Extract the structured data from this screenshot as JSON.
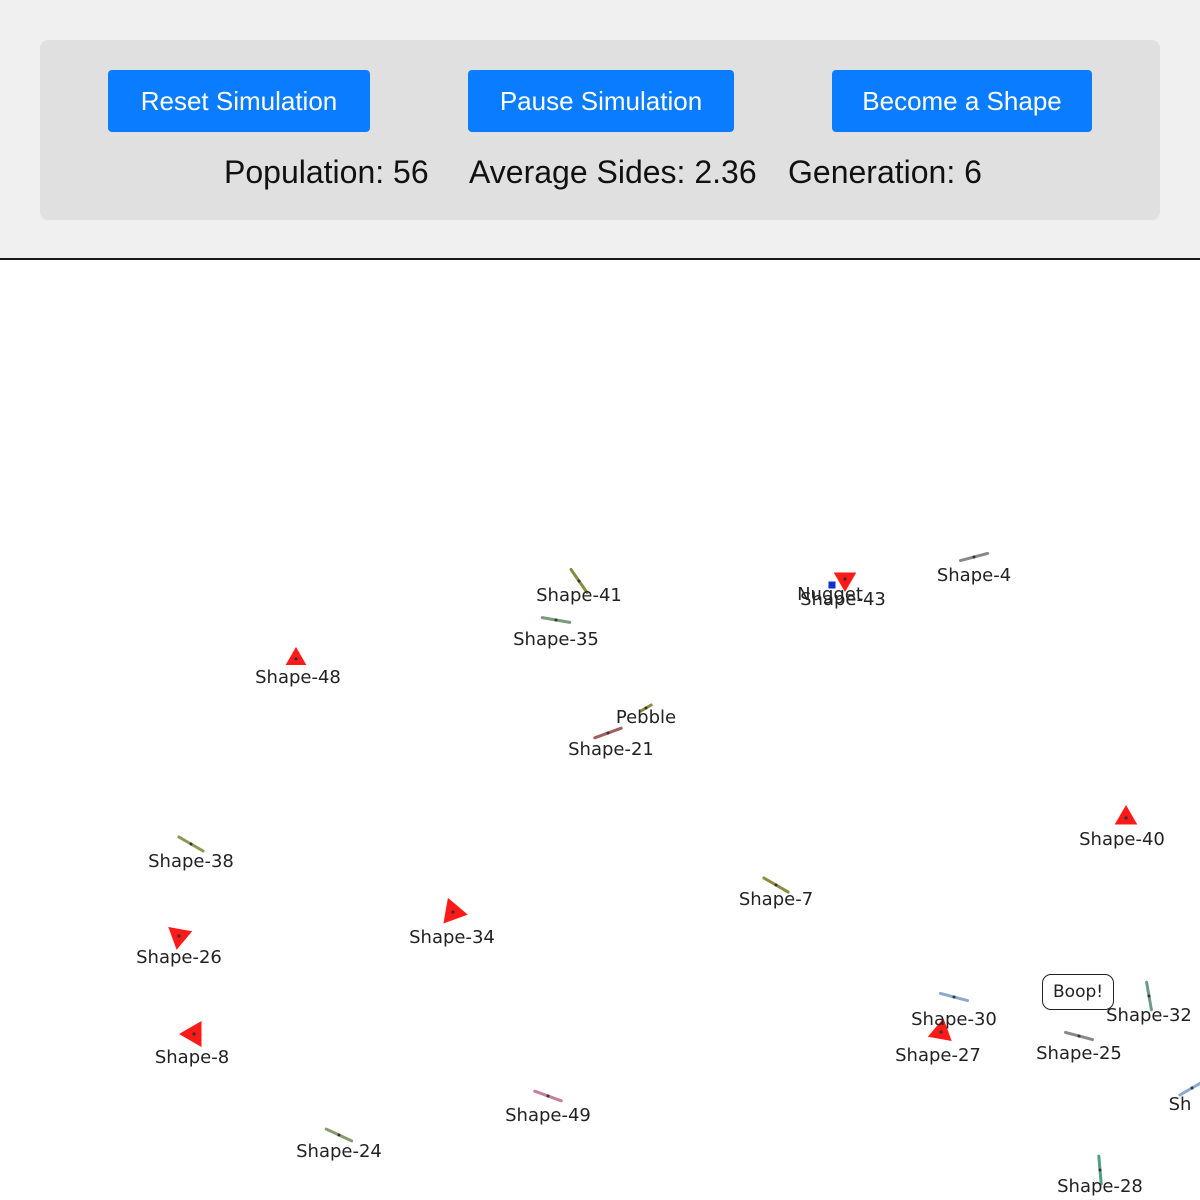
{
  "controls": {
    "reset_label": "Reset Simulation",
    "pause_label": "Pause Simulation",
    "become_label": "Become a Shape"
  },
  "stats": {
    "population": "Population: 56",
    "average_sides": "Average Sides: 2.36",
    "generation": "Generation: 6"
  },
  "colors": {
    "button": "#0a7cff",
    "triangle": "#ff1a1a",
    "speech_border": "#222222"
  },
  "shapes": [
    {
      "name": "Shape-41",
      "kind": "line",
      "color": "#8a8a40"
    },
    {
      "name": "Shape-35",
      "kind": "line",
      "color": "#7a9a7a"
    },
    {
      "name": "Shape-43",
      "kind": "triangle",
      "color": "#ff1a1a"
    },
    {
      "name": "Nugget",
      "kind": "square",
      "color": "#1030d0"
    },
    {
      "name": "Shape-4",
      "kind": "line",
      "color": "#888888"
    },
    {
      "name": "Shape-48",
      "kind": "triangle",
      "color": "#ff1a1a"
    },
    {
      "name": "Pebble",
      "kind": "line",
      "color": "#a06060"
    },
    {
      "name": "Shape-21",
      "kind": "line",
      "color": "#8a8a40"
    },
    {
      "name": "Shape-40",
      "kind": "triangle",
      "color": "#ff1a1a"
    },
    {
      "name": "Shape-38",
      "kind": "line",
      "color": "#8a9a50"
    },
    {
      "name": "Shape-7",
      "kind": "line",
      "color": "#8a8a40"
    },
    {
      "name": "Shape-34",
      "kind": "triangle",
      "color": "#ff1a1a"
    },
    {
      "name": "Shape-26",
      "kind": "triangle",
      "color": "#ff1a1a"
    },
    {
      "name": "Shape-30",
      "kind": "line",
      "color": "#8aaad0"
    },
    {
      "name": "Shape-27",
      "kind": "triangle",
      "color": "#ff1a1a"
    },
    {
      "name": "Shape-32",
      "kind": "line",
      "color": "#6a9a8a"
    },
    {
      "name": "Shape-25",
      "kind": "line",
      "color": "#888888"
    },
    {
      "name": "Shape-8",
      "kind": "triangle",
      "color": "#ff1a1a"
    },
    {
      "name": "Shape-49",
      "kind": "line",
      "color": "#c080a0"
    },
    {
      "name": "Shape-24",
      "kind": "line",
      "color": "#8a9a70"
    },
    {
      "name": "Shape-28",
      "kind": "line",
      "color": "#50a080"
    },
    {
      "name": "Sh",
      "kind": "line",
      "color": "#8aaad0"
    }
  ],
  "speech": {
    "text": "Boop!"
  }
}
